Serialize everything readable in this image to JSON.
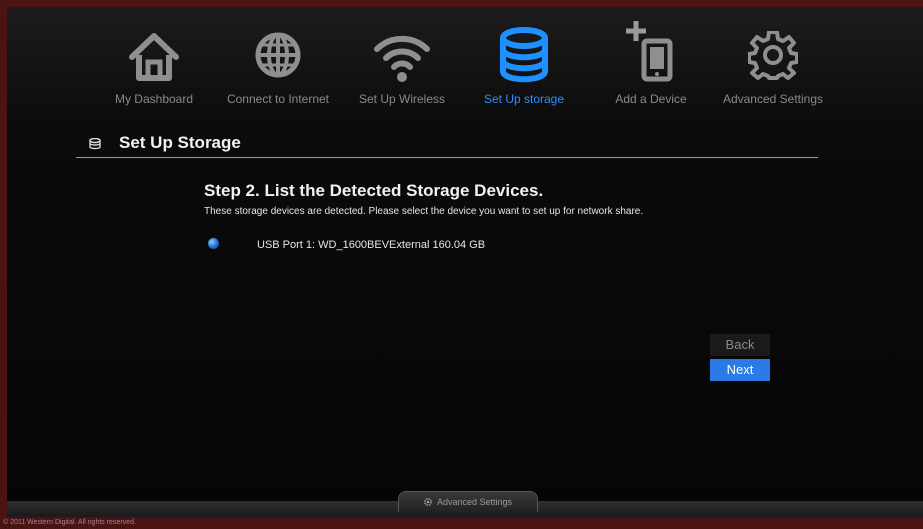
{
  "nav": {
    "items": [
      {
        "label": "My Dashboard",
        "icon": "home-icon"
      },
      {
        "label": "Connect to Internet",
        "icon": "globe-icon"
      },
      {
        "label": "Set Up Wireless",
        "icon": "wifi-icon"
      },
      {
        "label": "Set Up storage",
        "icon": "storage-icon",
        "active": true
      },
      {
        "label": "Add a Device",
        "icon": "add-device-icon"
      },
      {
        "label": "Advanced Settings",
        "icon": "gear-icon"
      }
    ]
  },
  "page": {
    "title": "Set Up Storage",
    "step_title": "Step 2. List the Detected Storage Devices.",
    "step_desc": "These storage devices are detected. Please select the device you want to set up for network share."
  },
  "devices": [
    {
      "label": "USB Port 1:  WD_1600BEVExternal  160.04 GB",
      "selected": true
    }
  ],
  "buttons": {
    "back": "Back",
    "next": "Next"
  },
  "footer": {
    "tab_label": "Advanced Settings",
    "copyright": "© 2011 Western Digital. All rights reserved."
  },
  "colors": {
    "accent": "#2b7be6",
    "active_label": "#2d8fff"
  }
}
